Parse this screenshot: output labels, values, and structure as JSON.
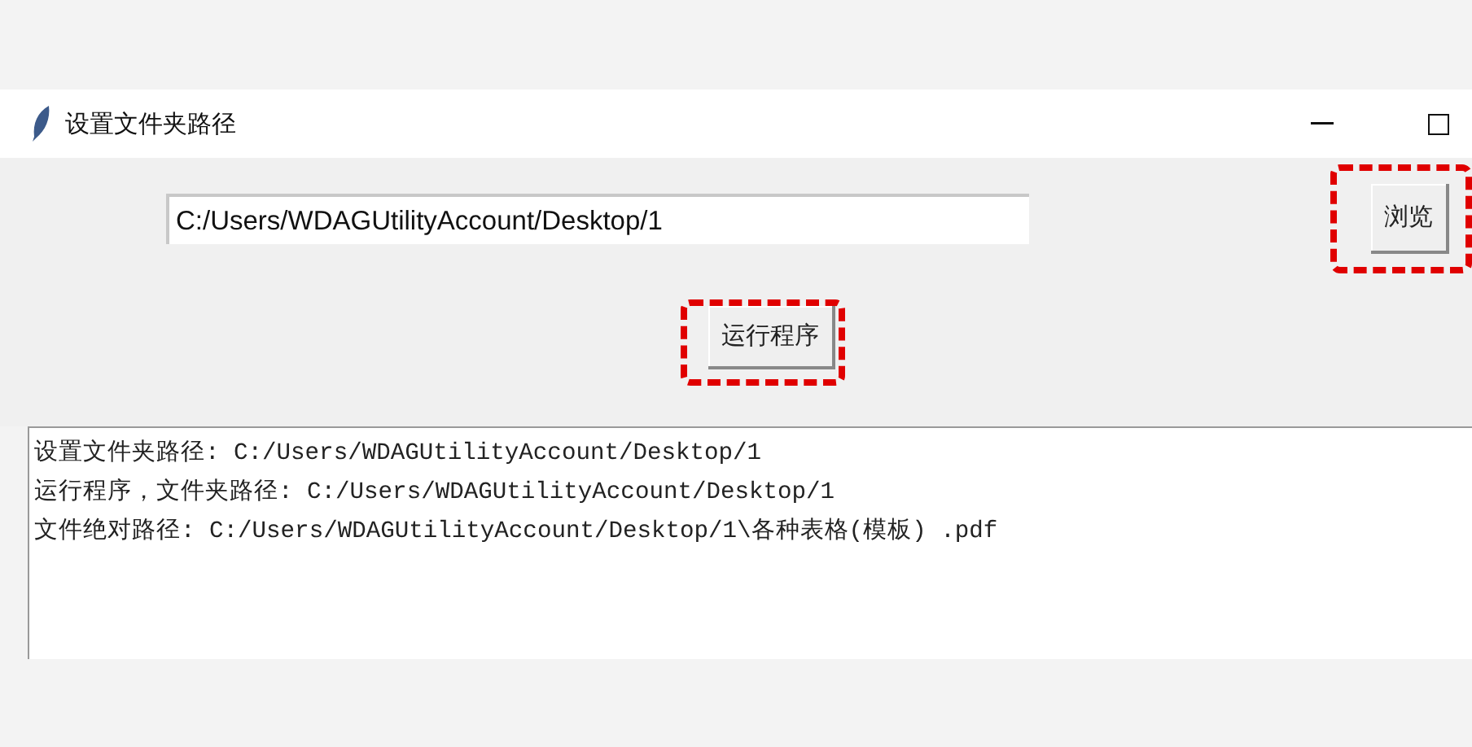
{
  "window": {
    "title": "设置文件夹路径"
  },
  "path_field": {
    "value": "C:/Users/WDAGUtilityAccount/Desktop/1"
  },
  "buttons": [
    {
      "kind": "browse",
      "label": "浏览",
      "highlighted": true
    },
    {
      "kind": "run",
      "label": "运行程序",
      "highlighted": true
    }
  ],
  "log": {
    "lines": [
      "设置文件夹路径: C:/Users/WDAGUtilityAccount/Desktop/1",
      "运行程序，文件夹路径: C:/Users/WDAGUtilityAccount/Desktop/1",
      "文件绝对路径: C:/Users/WDAGUtilityAccount/Desktop/1\\各种表格(模板) .pdf"
    ]
  }
}
